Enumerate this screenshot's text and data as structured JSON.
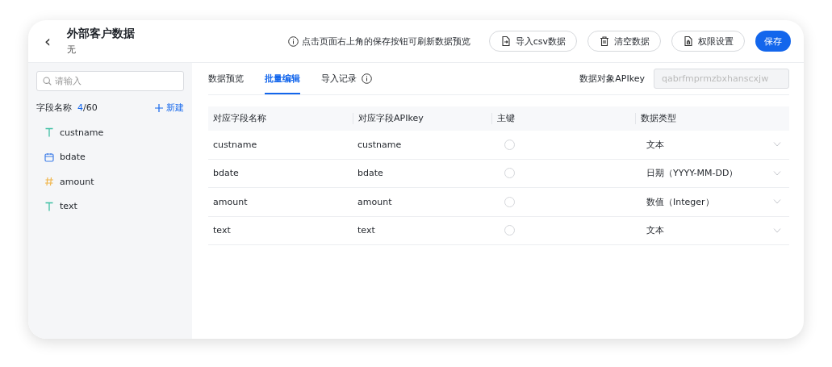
{
  "header": {
    "back": "‹",
    "title": "外部客户数据",
    "subtitle": "无",
    "hint": "点击页面右上角的保存按钮可刷新数据预览",
    "buttons": [
      {
        "kind": "import",
        "label": "导入csv数据"
      },
      {
        "kind": "clear",
        "label": "清空数据"
      },
      {
        "kind": "permission",
        "label": "权限设置"
      },
      {
        "kind": "primary",
        "label": "保存"
      }
    ]
  },
  "sidebar": {
    "search": {
      "placeholder": "请输入"
    },
    "heading": "字段名称",
    "count": "4",
    "total": "/60",
    "new_button": "新建",
    "fields": [
      {
        "kind": "text",
        "name": "custname"
      },
      {
        "kind": "date",
        "name": "bdate"
      },
      {
        "kind": "number",
        "name": "amount"
      },
      {
        "kind": "text",
        "name": "text"
      }
    ]
  },
  "tabs": [
    {
      "label": "数据预览",
      "selected": false,
      "info": false
    },
    {
      "label": "批量编辑",
      "selected": true,
      "info": false
    },
    {
      "label": "导入记录",
      "selected": false,
      "info": true
    }
  ],
  "apikey": {
    "label": "数据对象APIkey",
    "placeholder": "qabrfmprmzbxhanscxjw"
  },
  "table": {
    "columns": [
      "对应字段名称",
      "对应字段APIkey",
      "主键",
      "数据类型"
    ],
    "rows": [
      {
        "name": "custname",
        "apikey": "custname",
        "primary": false,
        "type": "文本"
      },
      {
        "name": "bdate",
        "apikey": "bdate",
        "primary": false,
        "type": "日期（YYYY-MM-DD）"
      },
      {
        "name": "amount",
        "apikey": "amount",
        "primary": false,
        "type": "数值（Integer）"
      },
      {
        "name": "text",
        "apikey": "text",
        "primary": false,
        "type": "文本"
      }
    ]
  }
}
